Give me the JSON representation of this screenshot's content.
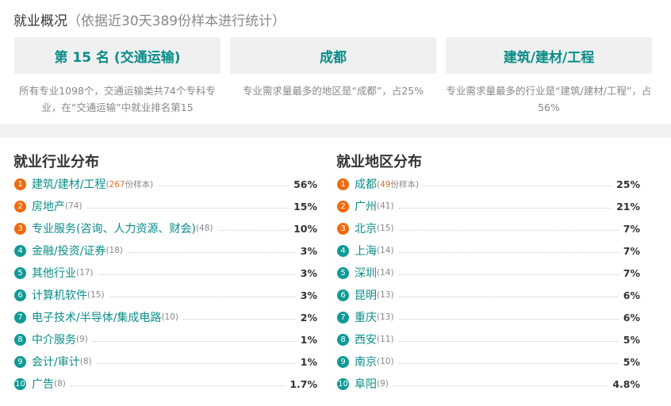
{
  "overview": {
    "title": "就业概况",
    "subtitle": "（依据近30天389份样本进行统计）",
    "cards": [
      {
        "value": "第 15 名 (交通运输)",
        "desc": "所有专业1098个，交通运输类共74个专科专业，在“交通运输”中就业排名第15"
      },
      {
        "value": "成都",
        "desc": "专业需求量最多的地区是“成都”，占25%"
      },
      {
        "value": "建筑/建材/工程",
        "desc": "专业需求量最多的行业是“建筑/建材/工程”，占56%"
      }
    ]
  },
  "industry": {
    "title": "就业行业分布",
    "items": [
      {
        "rank": "1",
        "name": "建筑/建材/工程",
        "count_open": "(",
        "count": "267",
        "count_tail": "份样本)",
        "pct": "56%"
      },
      {
        "rank": "2",
        "name": "房地产",
        "count": "(74)",
        "pct": "15%"
      },
      {
        "rank": "3",
        "name": "专业服务(咨询、人力资源、财会)",
        "count": "(48)",
        "pct": "10%"
      },
      {
        "rank": "4",
        "name": "金融/投资/证券",
        "count": "(18)",
        "pct": "3%"
      },
      {
        "rank": "5",
        "name": "其他行业",
        "count": "(17)",
        "pct": "3%"
      },
      {
        "rank": "6",
        "name": "计算机软件",
        "count": "(15)",
        "pct": "3%"
      },
      {
        "rank": "7",
        "name": "电子技术/半导体/集成电路",
        "count": "(10)",
        "pct": "2%"
      },
      {
        "rank": "8",
        "name": "中介服务",
        "count": "(9)",
        "pct": "1%"
      },
      {
        "rank": "9",
        "name": "会计/审计",
        "count": "(8)",
        "pct": "1%"
      },
      {
        "rank": "10",
        "name": "广告",
        "count": "(8)",
        "pct": "1.7%"
      }
    ]
  },
  "region": {
    "title": "就业地区分布",
    "items": [
      {
        "rank": "1",
        "name": "成都",
        "count_open": "(",
        "count": "49",
        "count_tail": "份样本)",
        "pct": "25%"
      },
      {
        "rank": "2",
        "name": "广州",
        "count": "(41)",
        "pct": "21%"
      },
      {
        "rank": "3",
        "name": "北京",
        "count": "(15)",
        "pct": "7%"
      },
      {
        "rank": "4",
        "name": "上海",
        "count": "(14)",
        "pct": "7%"
      },
      {
        "rank": "5",
        "name": "深圳",
        "count": "(14)",
        "pct": "7%"
      },
      {
        "rank": "6",
        "name": "昆明",
        "count": "(13)",
        "pct": "6%"
      },
      {
        "rank": "7",
        "name": "重庆",
        "count": "(13)",
        "pct": "6%"
      },
      {
        "rank": "8",
        "name": "西安",
        "count": "(11)",
        "pct": "5%"
      },
      {
        "rank": "9",
        "name": "南京",
        "count": "(10)",
        "pct": "5%"
      },
      {
        "rank": "10",
        "name": "阜阳",
        "count": "(9)",
        "pct": "4.8%"
      }
    ]
  },
  "colors": {
    "accent": "#0a8d8a",
    "rank_top": "#f06a0e",
    "rank_other": "#119a95",
    "highlight_count": "#e07020"
  }
}
